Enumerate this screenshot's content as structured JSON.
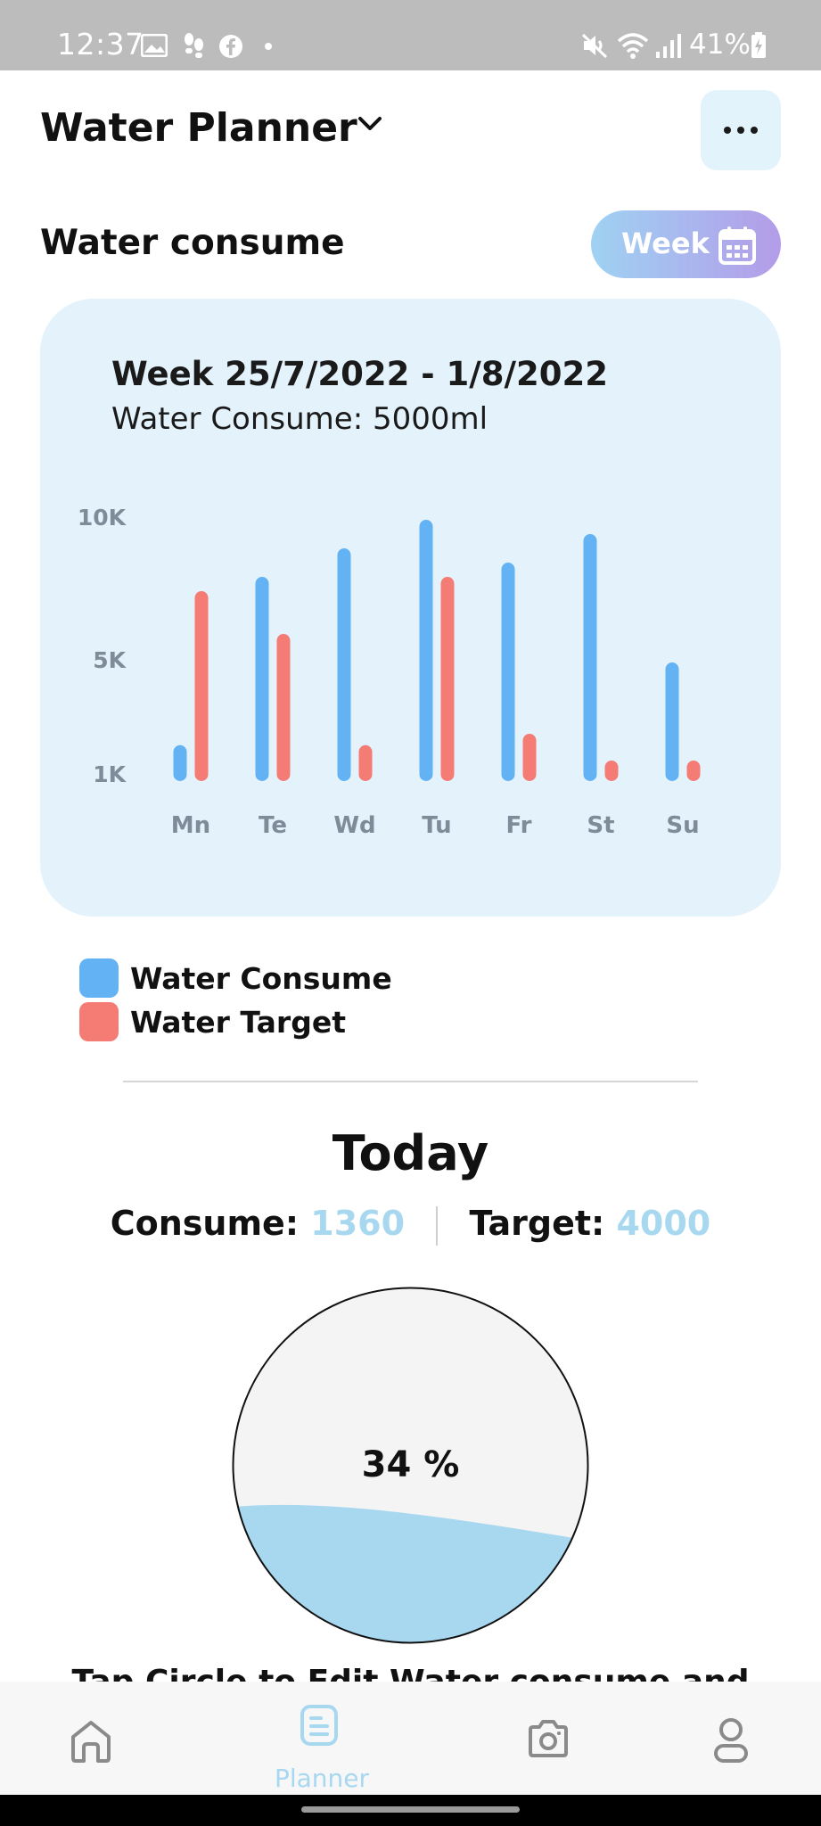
{
  "status_bar": {
    "time": "12:37",
    "battery": "41%",
    "left_icons": [
      "gallery-icon",
      "shoe-icon",
      "facebook-icon",
      "dot-icon"
    ],
    "right_icons": [
      "mute-icon",
      "wifi-icon",
      "signal-icon",
      "battery-icon"
    ]
  },
  "header": {
    "title": "Water Planner",
    "more_icon": "more-horizontal-icon"
  },
  "section": {
    "title": "Water consume",
    "period_button": "Week",
    "period_icon": "calendar-icon"
  },
  "chart_card": {
    "heading": "Week 25/7/2022 - 1/8/2022",
    "subheading": "Water Consume: 5000ml"
  },
  "chart_data": {
    "type": "bar",
    "categories": [
      "Mn",
      "Te",
      "Wd",
      "Tu",
      "Fr",
      "St",
      "Su"
    ],
    "y_ticks": [
      "10K",
      "5K",
      "1K"
    ],
    "ylim": [
      1000,
      10000
    ],
    "grid": false,
    "legend_position": "bottom-left",
    "series": [
      {
        "name": "Water Consume",
        "color": "#63b3f4",
        "values": [
          2100,
          8000,
          9000,
          10000,
          8500,
          9500,
          5000
        ]
      },
      {
        "name": "Water Target",
        "color": "#f47c74",
        "values": [
          7500,
          6000,
          2100,
          8000,
          2500,
          1000,
          1000
        ]
      }
    ]
  },
  "legend": [
    {
      "label": "Water Consume",
      "color": "#63b3f4"
    },
    {
      "label": "Water Target",
      "color": "#f47c74"
    }
  ],
  "today": {
    "title": "Today",
    "consume_label": "Consume:",
    "consume_value": "1360",
    "target_label": "Target:",
    "target_value": "4000",
    "percent": 34,
    "percent_label": "34 %",
    "hint": "Tap Circle to Edit Water consume and"
  },
  "bottom_nav": {
    "items": [
      {
        "icon": "home-icon",
        "label": ""
      },
      {
        "icon": "planner-icon",
        "label": "Planner",
        "active": true
      },
      {
        "icon": "camera-icon",
        "label": ""
      },
      {
        "icon": "profile-icon",
        "label": ""
      }
    ]
  }
}
